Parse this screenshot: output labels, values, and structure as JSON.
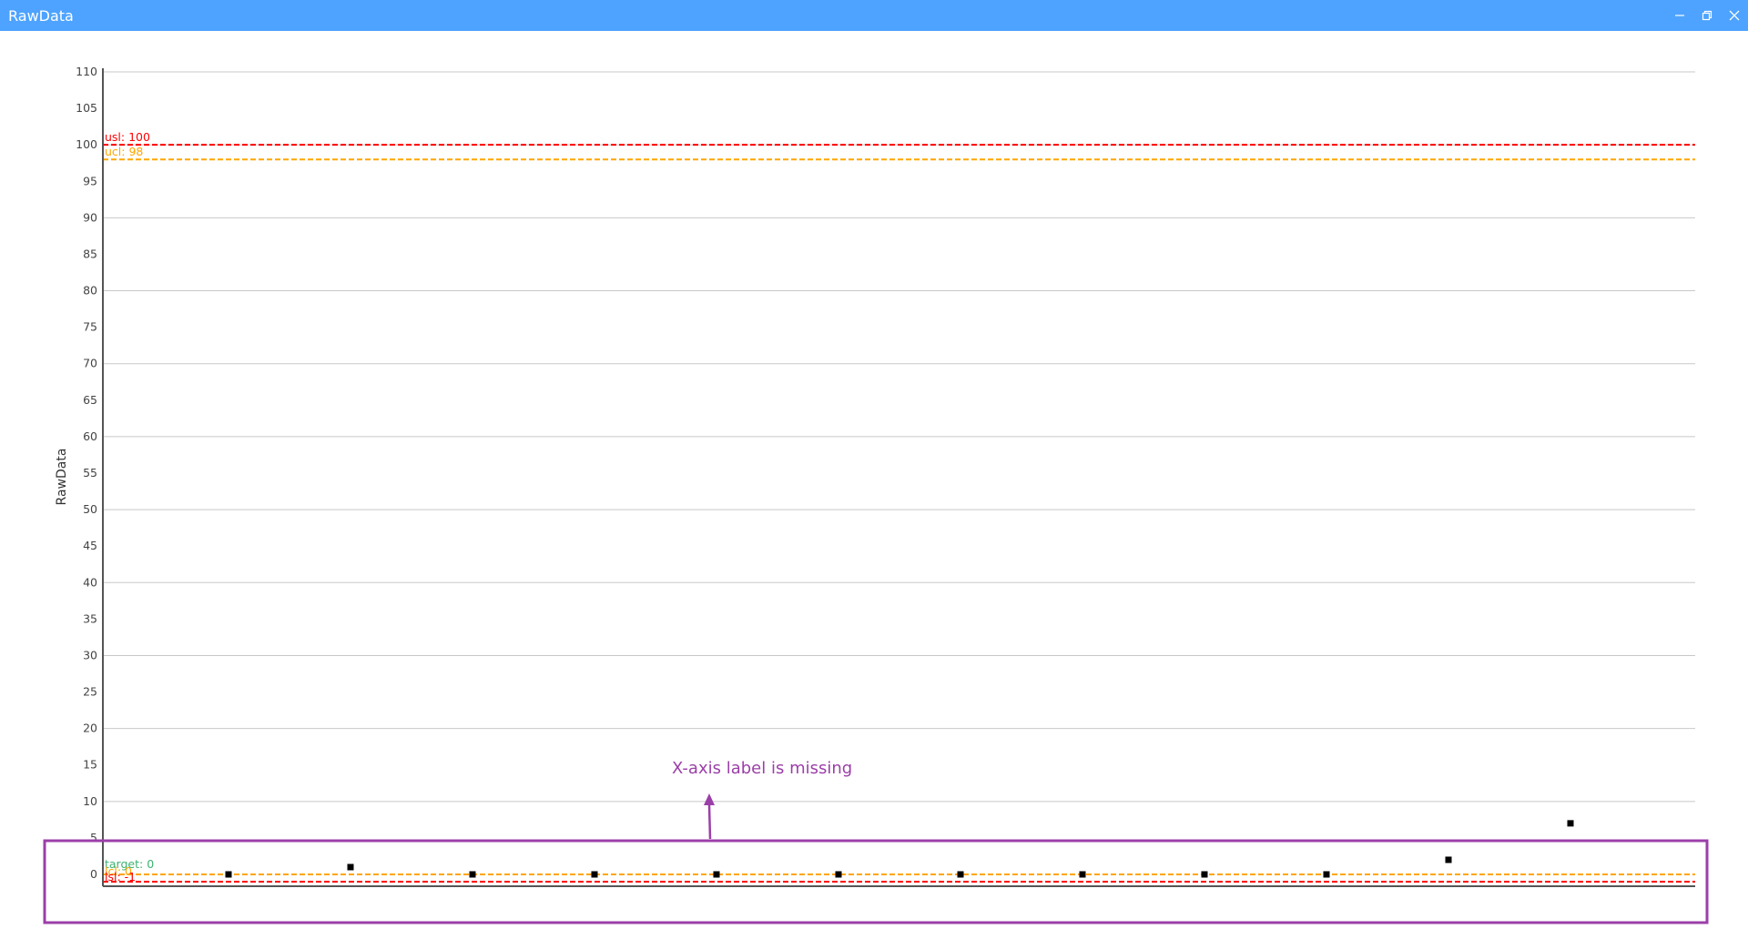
{
  "window": {
    "title": "RawData",
    "controls": [
      "minimize-icon",
      "restore-icon",
      "close-icon"
    ]
  },
  "colors": {
    "titlebar": "#4da3ff",
    "usl": "#ff0000",
    "lsl": "#ff0000",
    "ucl": "#ffa500",
    "lcl": "#ffa500",
    "target": "#3cb371",
    "grid": "#c8c8c8",
    "points": "#000000",
    "annotation": "#9b3fa8"
  },
  "annotation": {
    "text": "X-axis label is missing"
  },
  "chart_data": {
    "type": "scatter",
    "title": "",
    "xlabel": "",
    "ylabel": "RawData",
    "ylim": [
      -2,
      110
    ],
    "yticks": [
      0,
      5,
      10,
      15,
      20,
      25,
      30,
      35,
      40,
      45,
      50,
      55,
      60,
      65,
      70,
      75,
      80,
      85,
      90,
      95,
      100,
      105,
      110
    ],
    "grid": true,
    "x": [
      1,
      2,
      3,
      4,
      5,
      6,
      7,
      8,
      9,
      10,
      11,
      12
    ],
    "values": [
      0,
      1,
      0,
      0,
      0,
      0,
      0,
      0,
      0,
      0,
      2,
      7
    ],
    "reference_lines": [
      {
        "key": "usl",
        "label": "usl: 100",
        "value": 100
      },
      {
        "key": "ucl",
        "label": "ucl: 98",
        "value": 98
      },
      {
        "key": "target",
        "label": "target: 0",
        "value": 0
      },
      {
        "key": "lcl",
        "label": "lcl: 0",
        "value": 0
      },
      {
        "key": "lsl",
        "label": "lsl: -1",
        "value": -1
      }
    ]
  }
}
